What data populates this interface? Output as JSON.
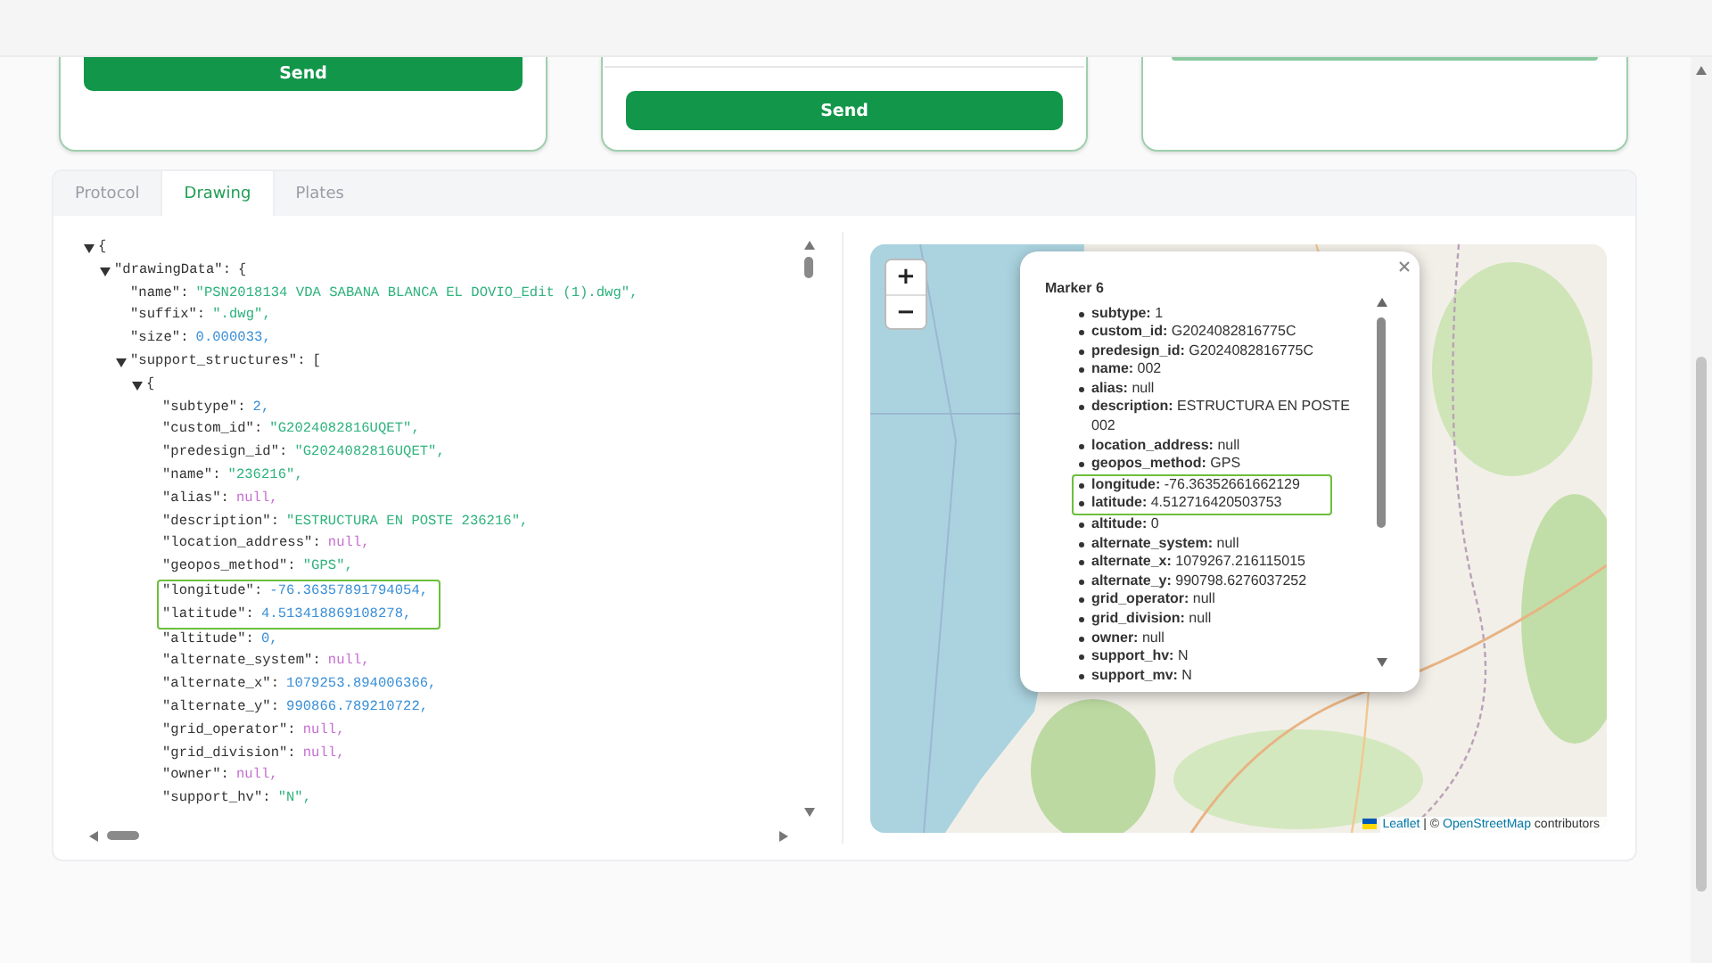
{
  "cards": [
    {
      "kind": "button-only",
      "button": "Send"
    },
    {
      "kind": "field-and-button",
      "button": "Send"
    },
    {
      "kind": "field-edge"
    }
  ],
  "tabs": [
    {
      "label": "Protocol",
      "selected": false
    },
    {
      "label": "Drawing",
      "selected": true
    },
    {
      "label": "Plates",
      "selected": false
    }
  ],
  "json_view": {
    "nodes": [
      {
        "kind": "branch",
        "open": "{",
        "expanded": true,
        "children": [
          {
            "kind": "branch",
            "key": "\"drawingData\":",
            "open": "{",
            "expanded": true,
            "children": [
              {
                "kind": "string",
                "key": "\"name\":",
                "value": "\"PSN2018134 VDA SABANA BLANCA EL DOVIO_Edit (1).dwg\","
              },
              {
                "kind": "string",
                "key": "\"suffix\":",
                "value": "\".dwg\","
              },
              {
                "kind": "number",
                "key": "\"size\":",
                "value": "0.000033,"
              },
              {
                "kind": "branch",
                "key": "\"support_structures\":",
                "open": "[",
                "expanded": true,
                "children": [
                  {
                    "kind": "branch",
                    "open": "{",
                    "expanded": true,
                    "children": [
                      {
                        "kind": "number",
                        "key": "\"subtype\":",
                        "value": "2,"
                      },
                      {
                        "kind": "string",
                        "key": "\"custom_id\":",
                        "value": "\"G2024082816UQET\","
                      },
                      {
                        "kind": "string",
                        "key": "\"predesign_id\":",
                        "value": "\"G2024082816UQET\","
                      },
                      {
                        "kind": "string",
                        "key": "\"name\":",
                        "value": "\"236216\","
                      },
                      {
                        "kind": "null",
                        "key": "\"alias\":",
                        "value": "null,"
                      },
                      {
                        "kind": "string",
                        "key": "\"description\":",
                        "value": "\"ESTRUCTURA EN POSTE 236216\","
                      },
                      {
                        "kind": "null",
                        "key": "\"location_address\":",
                        "value": "null,"
                      },
                      {
                        "kind": "string",
                        "key": "\"geopos_method\":",
                        "value": "\"GPS\","
                      },
                      {
                        "kind": "highlight",
                        "lines": [
                          {
                            "kind": "number",
                            "key": "\"longitude\":",
                            "value": "-76.36357891794054,"
                          },
                          {
                            "kind": "number",
                            "key": "\"latitude\":",
                            "value": "4.513418869108278,"
                          }
                        ]
                      },
                      {
                        "kind": "number",
                        "key": "\"altitude\":",
                        "value": "0,"
                      },
                      {
                        "kind": "null",
                        "key": "\"alternate_system\":",
                        "value": "null,"
                      },
                      {
                        "kind": "number",
                        "key": "\"alternate_x\":",
                        "value": "1079253.894006366,"
                      },
                      {
                        "kind": "number",
                        "key": "\"alternate_y\":",
                        "value": "990866.789210722,"
                      },
                      {
                        "kind": "null",
                        "key": "\"grid_operator\":",
                        "value": "null,"
                      },
                      {
                        "kind": "null",
                        "key": "\"grid_division\":",
                        "value": "null,"
                      },
                      {
                        "kind": "null",
                        "key": "\"owner\":",
                        "value": "null,"
                      },
                      {
                        "kind": "string",
                        "key": "\"support_hv\":",
                        "value": "\"N\","
                      }
                    ]
                  }
                ]
              }
            ]
          }
        ]
      }
    ]
  },
  "map": {
    "zoom_in": "+",
    "zoom_out": "−",
    "popup": {
      "title": "Marker 6",
      "items": [
        {
          "kind": "entry",
          "text": "**subtype:** 1"
        },
        {
          "kind": "entry",
          "text": "**custom_id:** G2024082816775C"
        },
        {
          "kind": "entry",
          "text": "**predesign_id:** G2024082816775C"
        },
        {
          "kind": "entry",
          "text": "**name:** 002"
        },
        {
          "kind": "entry",
          "text": "**alias:** null"
        },
        {
          "kind": "entry",
          "text": "**description:** ESTRUCTURA EN POSTE 002"
        },
        {
          "kind": "entry",
          "text": "**location_address:** null"
        },
        {
          "kind": "entry",
          "text": "**geopos_method:** GPS"
        },
        {
          "kind": "highlight",
          "items": [
            {
              "text": "**longitude:** -76.36352661662129"
            },
            {
              "text": "**latitude:** 4.512716420503753"
            }
          ]
        },
        {
          "kind": "entry",
          "text": "**altitude:** 0"
        },
        {
          "kind": "entry",
          "text": "**alternate_system:** null"
        },
        {
          "kind": "entry",
          "text": "**alternate_x:** 1079267.216115015"
        },
        {
          "kind": "entry",
          "text": "**alternate_y:** 990798.6276037252"
        },
        {
          "kind": "entry",
          "text": "**grid_operator:** null"
        },
        {
          "kind": "entry",
          "text": "**grid_division:** null"
        },
        {
          "kind": "entry",
          "text": "**owner:** null"
        },
        {
          "kind": "entry",
          "text": "**support_hv:** N"
        },
        {
          "kind": "entry",
          "text": "**support_mv:** N"
        }
      ]
    },
    "attribution": [
      {
        "kind": "link",
        "text": "Leaflet"
      },
      {
        "kind": "text",
        "text": "| ©"
      },
      {
        "kind": "link",
        "text": "OpenStreetMap"
      },
      {
        "kind": "text",
        "text": "contributors"
      }
    ]
  }
}
